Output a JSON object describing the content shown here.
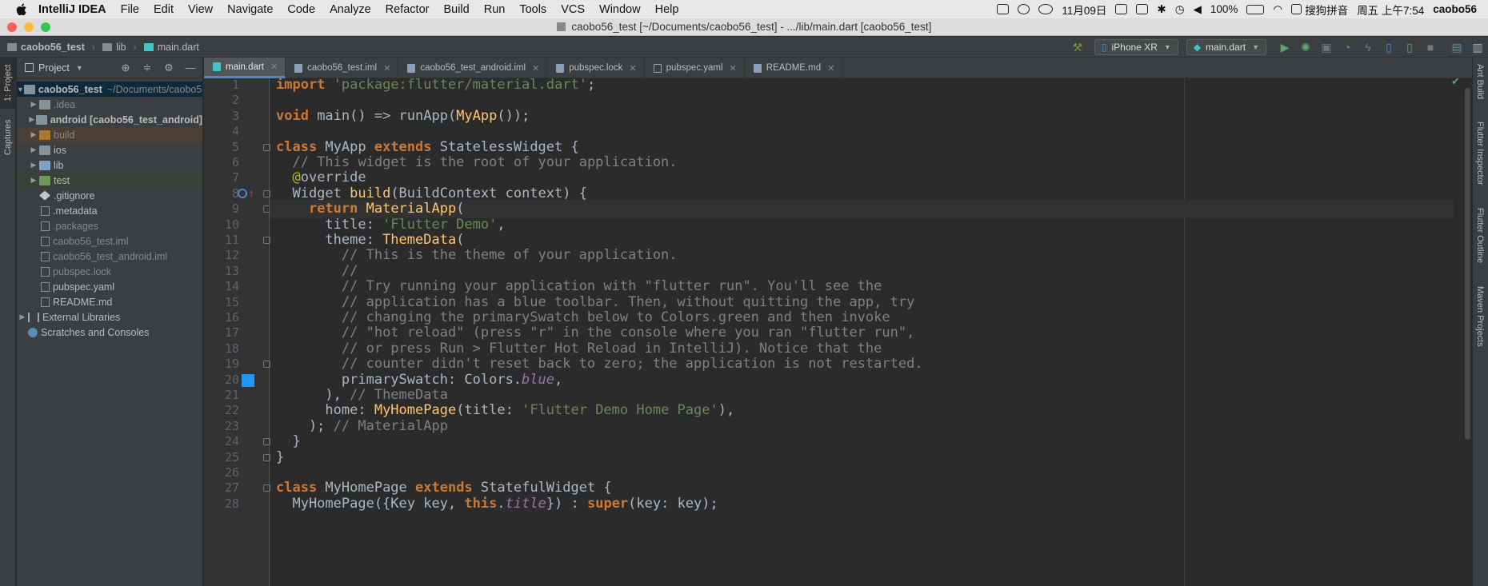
{
  "menubar": {
    "app": "IntelliJ IDEA",
    "items": [
      "File",
      "Edit",
      "View",
      "Navigate",
      "Code",
      "Analyze",
      "Refactor",
      "Build",
      "Run",
      "Tools",
      "VCS",
      "Window",
      "Help"
    ],
    "date": "11月09日",
    "battery": "100%",
    "ime": "搜狗拼音",
    "clock": "周五 上午7:54",
    "user": "caobo56"
  },
  "window": {
    "title": "caobo56_test [~/Documents/caobo56_test] - .../lib/main.dart [caobo56_test]"
  },
  "navbar": {
    "crumbs": [
      "caobo56_test",
      "lib",
      "main.dart"
    ],
    "device": "iPhone XR",
    "config": "main.dart"
  },
  "left_tabs": {
    "project": "1: Project",
    "captures": "Captures"
  },
  "right_tabs": {
    "ant": "Ant Build",
    "inspector": "Flutter Inspector",
    "outline": "Flutter Outline",
    "maven": "Maven Projects"
  },
  "project": {
    "title": "Project",
    "root": "caobo56_test",
    "root_path": "~/Documents/caobo56_test",
    "tree": [
      {
        "label": ".idea",
        "type": "folder",
        "gray": true
      },
      {
        "label": "android [caobo56_test_android]",
        "type": "folder",
        "bold": true
      },
      {
        "label": "build",
        "type": "build",
        "gray": true
      },
      {
        "label": "ios",
        "type": "folder"
      },
      {
        "label": "lib",
        "type": "lib"
      },
      {
        "label": "test",
        "type": "test"
      },
      {
        "label": ".gitignore",
        "type": "git"
      },
      {
        "label": ".metadata",
        "type": "file"
      },
      {
        "label": ".packages",
        "type": "file",
        "gray": true
      },
      {
        "label": "caobo56_test.iml",
        "type": "file",
        "gray": true
      },
      {
        "label": "caobo56_test_android.iml",
        "type": "file",
        "gray": true
      },
      {
        "label": "pubspec.lock",
        "type": "file",
        "gray": true
      },
      {
        "label": "pubspec.yaml",
        "type": "file"
      },
      {
        "label": "README.md",
        "type": "file"
      }
    ],
    "external": "External Libraries",
    "scratches": "Scratches and Consoles"
  },
  "tabs": [
    {
      "label": "main.dart",
      "icon": "dart",
      "active": true
    },
    {
      "label": "caobo56_test.iml",
      "icon": "file"
    },
    {
      "label": "caobo56_test_android.iml",
      "icon": "file"
    },
    {
      "label": "pubspec.lock",
      "icon": "file"
    },
    {
      "label": "pubspec.yaml",
      "icon": "yaml"
    },
    {
      "label": "README.md",
      "icon": "file"
    }
  ],
  "editor": {
    "current_line": 9,
    "lines": [
      [
        [
          "kw",
          "import "
        ],
        [
          "str",
          "'package:flutter/material.dart'"
        ],
        [
          "ln",
          ";"
        ]
      ],
      [],
      [
        [
          "kw",
          "void "
        ],
        [
          "ln",
          "main() => runApp("
        ],
        [
          "cls",
          "MyApp"
        ],
        [
          "ln",
          "());"
        ]
      ],
      [],
      [
        [
          "kw",
          "class "
        ],
        [
          "ln",
          "MyApp "
        ],
        [
          "kw",
          "extends "
        ],
        [
          "ln",
          "StatelessWidget {"
        ]
      ],
      [
        [
          "ln",
          "  "
        ],
        [
          "cm",
          "// This widget is the root of your application."
        ]
      ],
      [
        [
          "ln",
          "  "
        ],
        [
          "ann",
          "@"
        ],
        [
          "ln",
          "override"
        ]
      ],
      [
        [
          "ln",
          "  Widget "
        ],
        [
          "cls",
          "build"
        ],
        [
          "ln",
          "(BuildContext context) {"
        ]
      ],
      [
        [
          "ln",
          "    "
        ],
        [
          "kw",
          "return "
        ],
        [
          "cls",
          "MaterialApp"
        ],
        [
          "ln",
          "("
        ]
      ],
      [
        [
          "ln",
          "      title: "
        ],
        [
          "str",
          "'Flutter Demo'"
        ],
        [
          "ln",
          ","
        ]
      ],
      [
        [
          "ln",
          "      theme: "
        ],
        [
          "cls",
          "ThemeData"
        ],
        [
          "ln",
          "("
        ]
      ],
      [
        [
          "ln",
          "        "
        ],
        [
          "cm",
          "// This is the theme of your application."
        ]
      ],
      [
        [
          "ln",
          "        "
        ],
        [
          "cm",
          "//"
        ]
      ],
      [
        [
          "ln",
          "        "
        ],
        [
          "cm",
          "// Try running your application with \"flutter run\". You'll see the"
        ]
      ],
      [
        [
          "ln",
          "        "
        ],
        [
          "cm",
          "// application has a blue toolbar. Then, without quitting the app, try"
        ]
      ],
      [
        [
          "ln",
          "        "
        ],
        [
          "cm",
          "// changing the primarySwatch below to Colors.green and then invoke"
        ]
      ],
      [
        [
          "ln",
          "        "
        ],
        [
          "cm",
          "// \"hot reload\" (press \"r\" in the console where you ran \"flutter run\","
        ]
      ],
      [
        [
          "ln",
          "        "
        ],
        [
          "cm",
          "// or press Run > Flutter Hot Reload in IntelliJ). Notice that the"
        ]
      ],
      [
        [
          "ln",
          "        "
        ],
        [
          "cm",
          "// counter didn't reset back to zero; the application is not restarted."
        ]
      ],
      [
        [
          "ln",
          "        primarySwatch: Colors."
        ],
        [
          "it",
          "blue"
        ],
        [
          "ln",
          ","
        ]
      ],
      [
        [
          "ln",
          "      ), "
        ],
        [
          "cm",
          "// ThemeData"
        ]
      ],
      [
        [
          "ln",
          "      home: "
        ],
        [
          "cls",
          "MyHomePage"
        ],
        [
          "ln",
          "(title: "
        ],
        [
          "str",
          "'Flutter Demo Home Page'"
        ],
        [
          "ln",
          "),"
        ]
      ],
      [
        [
          "ln",
          "    ); "
        ],
        [
          "cm",
          "// MaterialApp"
        ]
      ],
      [
        [
          "ln",
          "  }"
        ]
      ],
      [
        [
          "ln",
          "}"
        ]
      ],
      [],
      [
        [
          "kw",
          "class "
        ],
        [
          "ln",
          "MyHomePage "
        ],
        [
          "kw",
          "extends "
        ],
        [
          "ln",
          "StatefulWidget {"
        ]
      ],
      [
        [
          "ln",
          "  MyHomePage({Key key, "
        ],
        [
          "kw",
          "this"
        ],
        [
          "ln",
          "."
        ],
        [
          "it",
          "title"
        ],
        [
          "ln",
          "}) : "
        ],
        [
          "kw",
          "super"
        ],
        [
          "ln",
          "(key: key);"
        ]
      ]
    ]
  },
  "colors": {
    "accent": "#4a88c7",
    "swatch": "#2196f3"
  }
}
